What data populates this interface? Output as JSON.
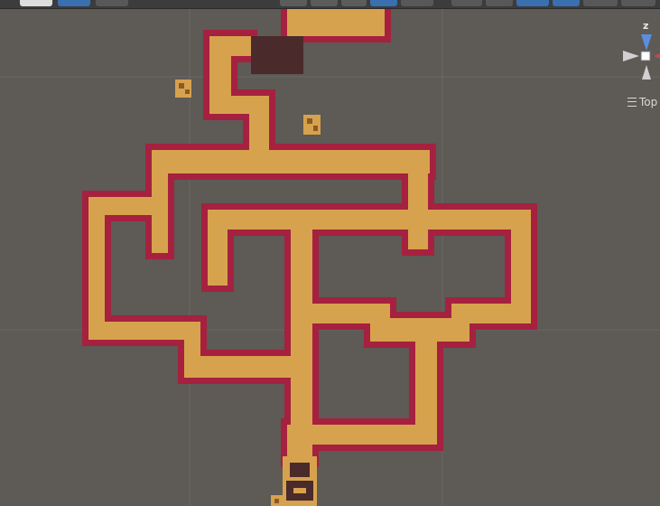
{
  "scene_view": {
    "projection_label": "Top",
    "axis_label": "z",
    "colors": {
      "background": "#5e5a55",
      "grid": "#6b6762",
      "floor": "#d7a24d",
      "wall": "#a5213f",
      "room_dark": "#4a2a2a",
      "gizmo_z": "#5a8fe0",
      "gizmo_neutral": "#d0d0d0"
    }
  },
  "toolbar": {
    "buttons": [
      {
        "name": "transform-field",
        "icon": "input-field-icon"
      },
      {
        "name": "pivot-button",
        "icon": "move-tool-icon"
      },
      {
        "name": "snap-button",
        "icon": "magnet-icon"
      },
      {
        "name": "shading-button",
        "icon": "globe-icon"
      },
      {
        "name": "lighting-button",
        "icon": "half-moon-icon"
      },
      {
        "name": "audio-button",
        "icon": "circle-icon"
      },
      {
        "name": "effects-button",
        "icon": "swirl-icon"
      },
      {
        "name": "gizmos-button",
        "icon": "bug-icon"
      },
      {
        "name": "camera-button",
        "icon": "camera-icon"
      },
      {
        "name": "tools-button",
        "icon": "cross-tool-icon"
      },
      {
        "name": "layers-button",
        "icon": "layers-icon"
      },
      {
        "name": "view-button",
        "icon": "view-icon"
      },
      {
        "name": "layout-button",
        "icon": "layout-icon"
      },
      {
        "name": "overflow-button",
        "icon": "more-icon"
      }
    ]
  }
}
